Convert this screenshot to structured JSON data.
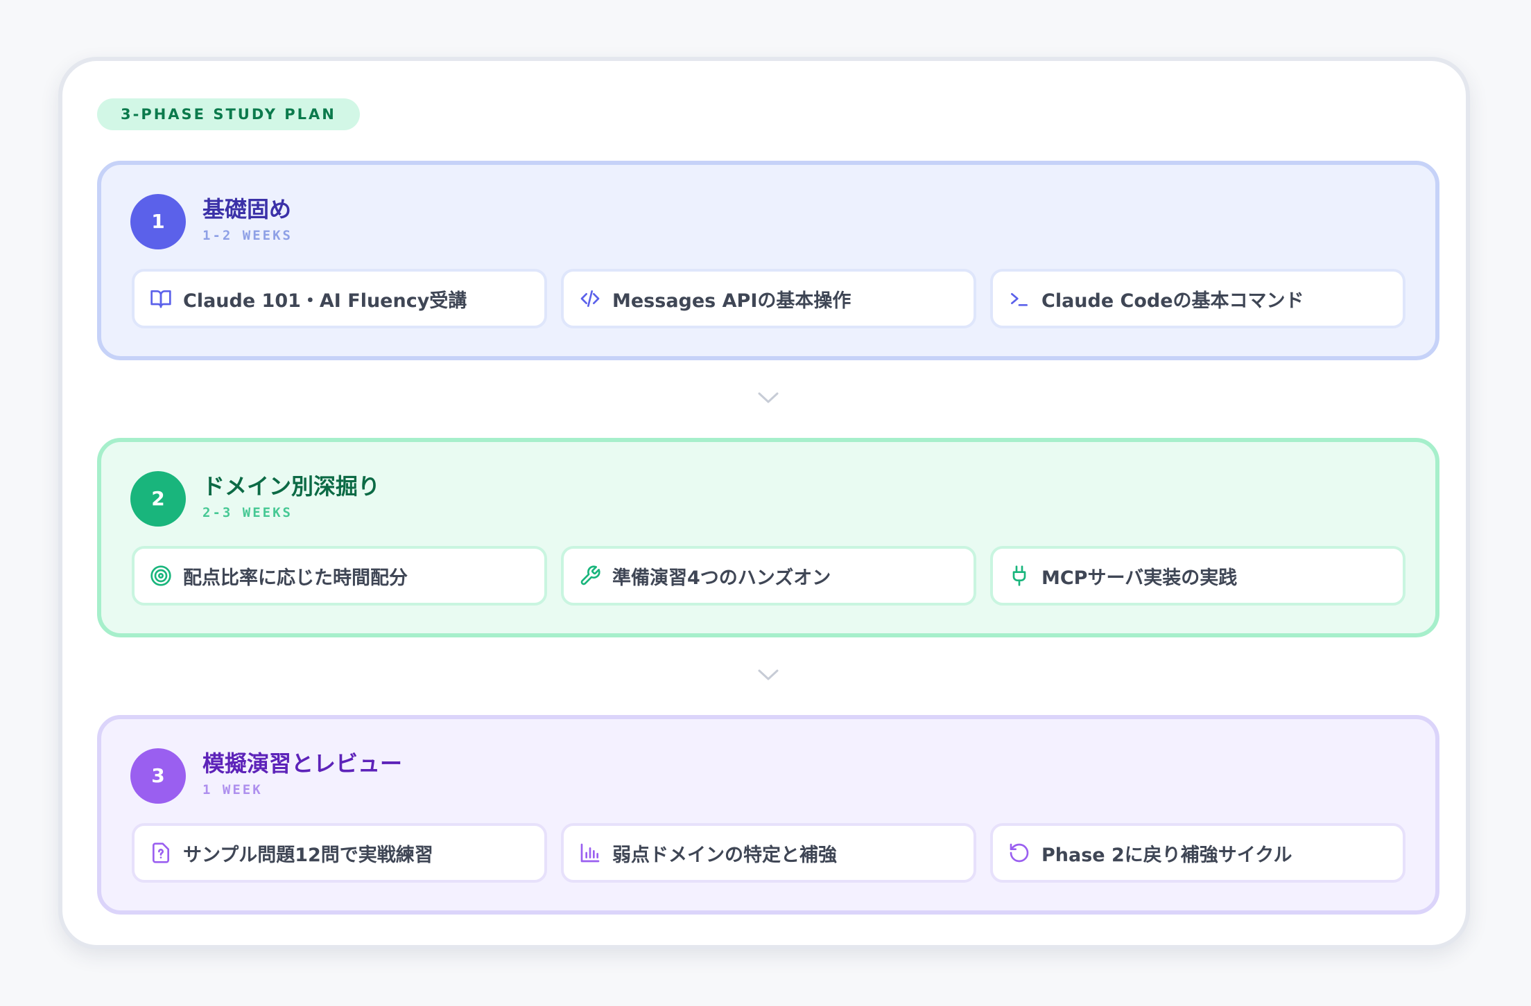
{
  "badge": "3-PHASE STUDY PLAN",
  "colors": {
    "phase1": "#5b61ea",
    "phase2": "#19b57c",
    "phase3": "#9a5ff0"
  },
  "phases": [
    {
      "number": "1",
      "title": "基礎固め",
      "duration": "1-2 WEEKS",
      "items": [
        {
          "icon": "book-icon",
          "label": "Claude 101・AI Fluency受講"
        },
        {
          "icon": "code-icon",
          "label": "Messages APIの基本操作"
        },
        {
          "icon": "terminal-icon",
          "label": "Claude Codeの基本コマンド"
        }
      ]
    },
    {
      "number": "2",
      "title": "ドメイン別深掘り",
      "duration": "2-3 WEEKS",
      "items": [
        {
          "icon": "target-icon",
          "label": "配点比率に応じた時間配分"
        },
        {
          "icon": "wrench-icon",
          "label": "準備演習4つのハンズオン"
        },
        {
          "icon": "plug-icon",
          "label": "MCPサーバ実装の実践"
        }
      ]
    },
    {
      "number": "3",
      "title": "模擬演習とレビュー",
      "duration": "1 WEEK",
      "items": [
        {
          "icon": "question-file-icon",
          "label": "サンプル問題12問で実戦練習"
        },
        {
          "icon": "bar-chart-icon",
          "label": "弱点ドメインの特定と補強"
        },
        {
          "icon": "rotate-ccw-icon",
          "label": "Phase 2に戻り補強サイクル"
        }
      ]
    }
  ]
}
